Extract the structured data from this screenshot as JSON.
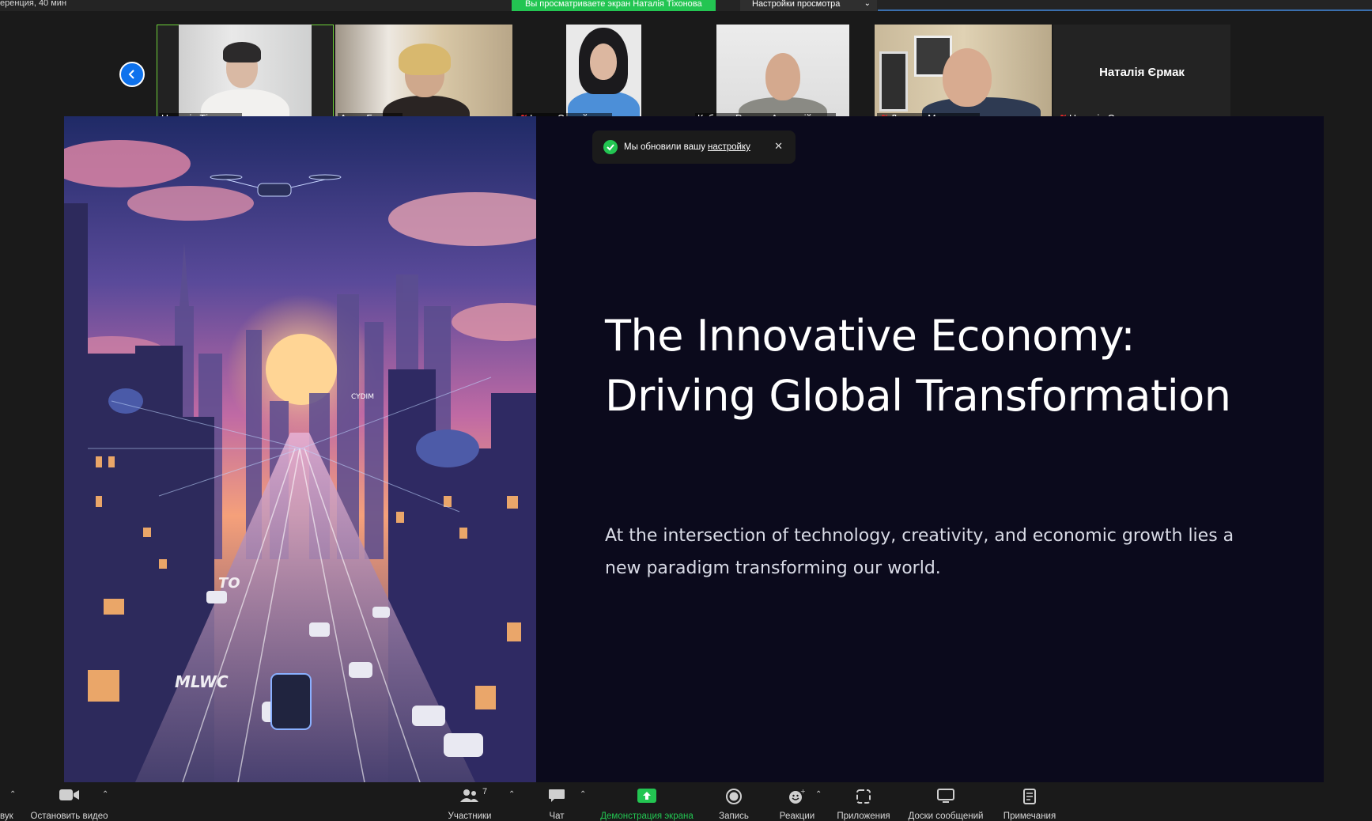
{
  "topbar": {
    "left_info": "еренция, 40 мин",
    "share_banner": "Вы просматриваете экран Наталія Тіхонова",
    "view_options": "Настройки просмотра"
  },
  "gallery": {
    "participants": [
      {
        "name": "Наталія Тіхонова",
        "muted": false,
        "video": true
      },
      {
        "name": "Алла Белова",
        "muted": false,
        "video": true
      },
      {
        "name": "Ірина Самойлова",
        "muted": true,
        "video": true
      },
      {
        "name": "КубановРуслан Анатолійович",
        "muted": false,
        "video": true
      },
      {
        "name": "Дмитро Макатьора",
        "muted": true,
        "video": true
      },
      {
        "name": "Наталія Єрмак",
        "muted": true,
        "video": false,
        "center_label": "Наталія Єрмак"
      }
    ]
  },
  "slide": {
    "title_line1": "The Innovative Economy:",
    "title_line2": "Driving Global Transformation",
    "subtitle": "At the intersection of technology, creativity, and economic growth lies a new paradigm transforming our world.",
    "image_labels": {
      "sign": "CYDIM",
      "road1": "TO",
      "road2": "MLWC"
    }
  },
  "toast": {
    "text": "Мы обновили вашу",
    "link": "настройку"
  },
  "toolbar": {
    "audio": "вук",
    "video": "Остановить видео",
    "participants": "Участники",
    "participants_count": "7",
    "chat": "Чат",
    "share_screen": "Демонстрация экрана",
    "record": "Запись",
    "reactions": "Реакции",
    "apps": "Приложения",
    "whiteboards": "Доски сообщений",
    "notes": "Примечания"
  },
  "colors": {
    "accent_green": "#23c552",
    "accent_blue": "#0e72ed",
    "slide_bg": "#0b0a1c"
  }
}
